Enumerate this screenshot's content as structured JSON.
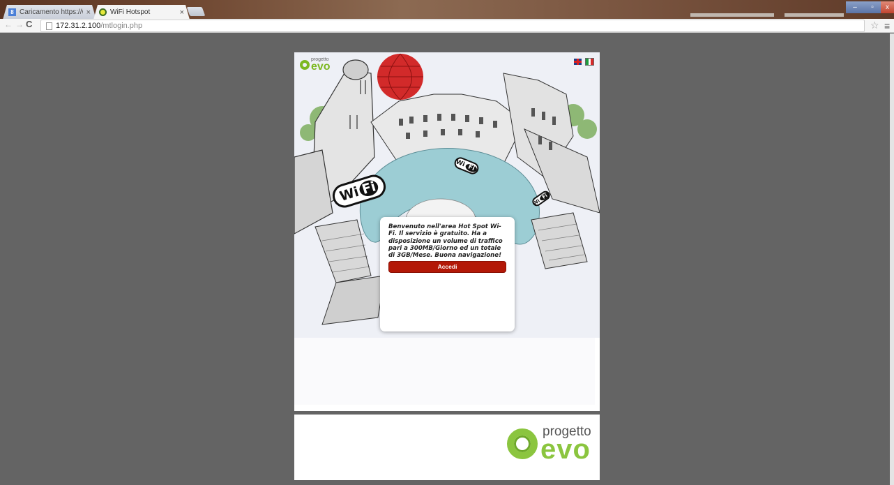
{
  "browser": {
    "tabs": [
      {
        "title": "Caricamento https://www",
        "active": false,
        "icon": "google-icon"
      },
      {
        "title": "WiFi Hotspot",
        "active": true,
        "icon": "wifi-favicon"
      }
    ],
    "tab_close": "×",
    "url_host": "172.31.2.100",
    "url_path": "/mtlogin.php",
    "back": "←",
    "forward": "→",
    "reload": "C",
    "star": "☆",
    "menu": "≡",
    "window_controls": {
      "minimize": "–",
      "maximize": "▫",
      "close": "x"
    }
  },
  "page": {
    "logo_small": {
      "top": "progetto",
      "bottom": "evo"
    },
    "languages": [
      "English",
      "Italiano"
    ],
    "wifi_badges": [
      {
        "wi": "Wi",
        "fi": "Fi"
      },
      {
        "wi": "Wi",
        "fi": "Fi"
      },
      {
        "wi": "Wi",
        "fi": "Fi"
      }
    ],
    "welcome_message": "Benvenuto nell'area Hot Spot Wi-Fi. Il servizio è gratuito. Ha a disposizione un volume di traffico pari a 300MB/Giorno ed un totale di 3GB/Mese. Buona navigazione!",
    "login_button": "Accedi",
    "logo_footer": {
      "top": "progetto",
      "bottom": "evo"
    }
  },
  "colors": {
    "accent_green": "#8bc53f",
    "button_red": "#b31807",
    "background": "#646464"
  }
}
